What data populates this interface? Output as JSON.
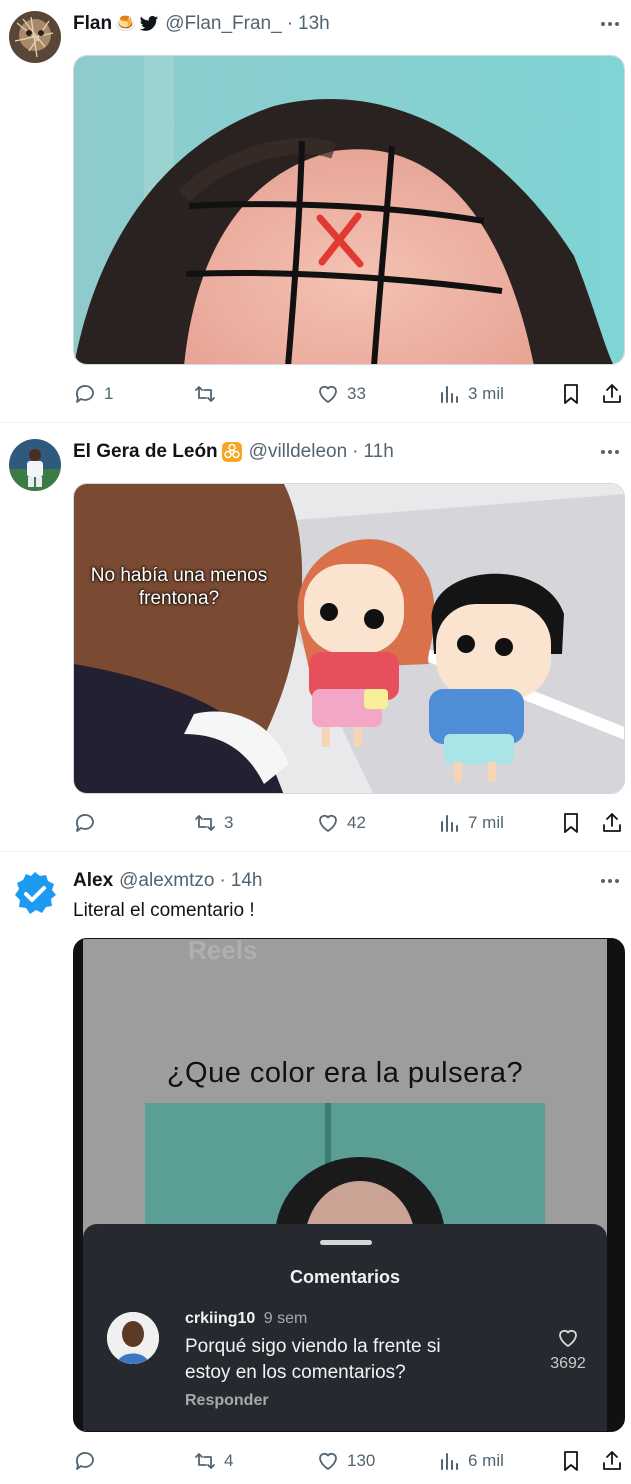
{
  "tweets": [
    {
      "display_name": "Flan",
      "name_emoji": "🍮",
      "handle": "@Flan_Fran_",
      "time": "13h",
      "actions": {
        "replies": "1",
        "retweets": "",
        "likes": "33",
        "views": "3 mil"
      }
    },
    {
      "display_name": "El Gera de León",
      "handle": "@villdeleon",
      "time": "11h",
      "media_caption": "No había una menos frentona?",
      "actions": {
        "replies": "",
        "retweets": "3",
        "likes": "42",
        "views": "7 mil"
      }
    },
    {
      "display_name": "Alex",
      "handle": "@alexmtzo",
      "time": "14h",
      "text": "Literal el comentario !",
      "media": {
        "reels_label": "Reels",
        "question": "¿Que color era la pulsera?",
        "comments_title": "Comentarios",
        "commenter": "crkiing10",
        "comment_age": "9 sem",
        "comment_text_line1": "Porqué sigo viendo la frente si",
        "comment_text_line2": "estoy en los comentarios?",
        "reply_label": "Responder",
        "comment_likes": "3692"
      },
      "actions": {
        "replies": "",
        "retweets": "4",
        "likes": "130",
        "views": "6 mil"
      }
    }
  ],
  "colors": {
    "text": "#0f1419",
    "muted": "#536471",
    "verified": "#1d9bf0",
    "divider": "#eff3f4"
  }
}
